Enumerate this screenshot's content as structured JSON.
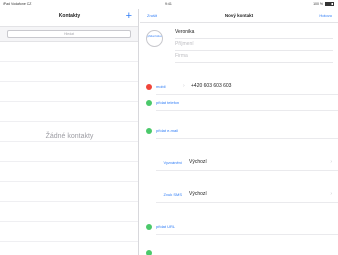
{
  "status_bar": {
    "carrier": "iPad Vodafone CZ  ",
    "time": "9:41",
    "battery": "100 %"
  },
  "left_pane": {
    "title": "Kontakty",
    "add_label": "+",
    "search_placeholder": "Hledat",
    "empty_label": "Žádné kontakty"
  },
  "right_pane": {
    "cancel_label": "Zrušit",
    "title": "Nový kontakt",
    "done_label": "Hotovo",
    "photo_label": "přidat fotku",
    "first_name_value": "Veronika",
    "last_name_placeholder": "Příjmení",
    "company_placeholder": "Firma",
    "phone_label": "mobil",
    "phone_value": "+420 603 603 603",
    "add_phone_label": "přidat telefon",
    "add_email_label": "přidat e-mail",
    "ringtone_label": "Vyzvánění",
    "ringtone_value": "Výchozí",
    "sms_label": "Zvuk SMS",
    "sms_value": "Výchozí",
    "add_url_label": "přidat URL"
  },
  "colors": {
    "accent": "#2e7cf6",
    "remove": "#f0453a",
    "add": "#4bc96b"
  },
  "icons": {
    "remove": "minus-circle-icon",
    "add": "plus-circle-icon",
    "chevron": "chevron-right-icon"
  }
}
